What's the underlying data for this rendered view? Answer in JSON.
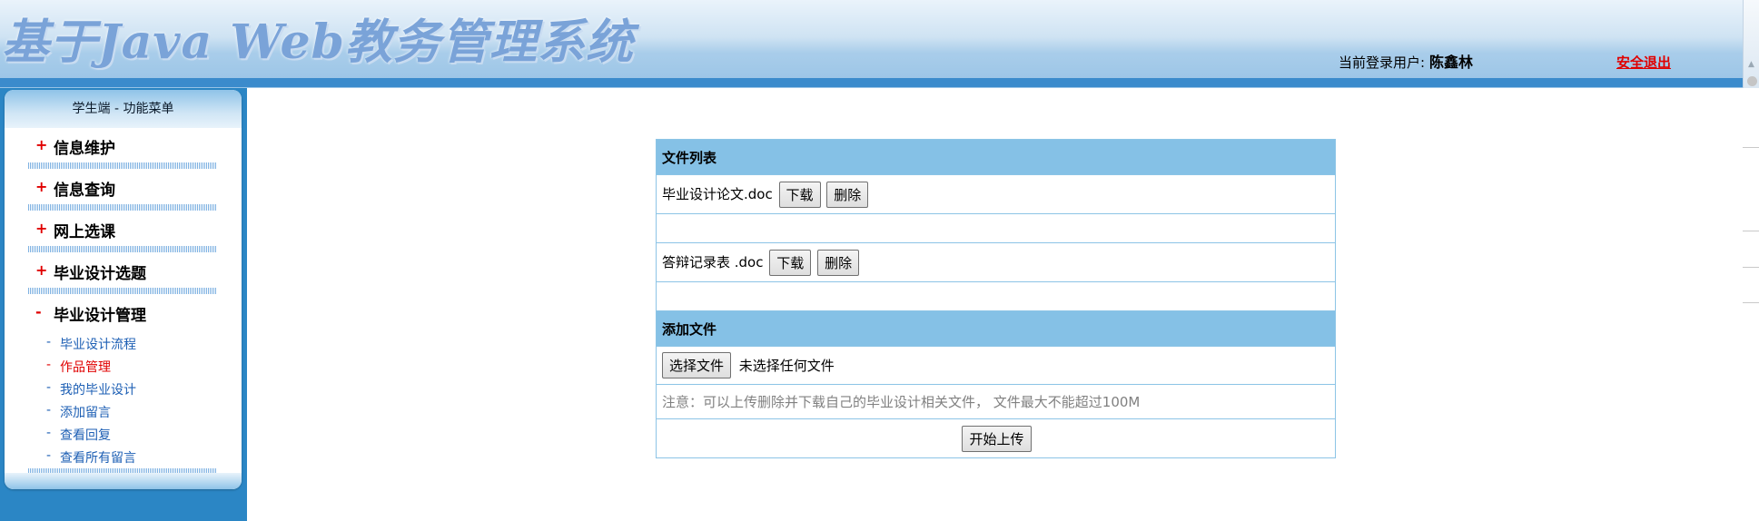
{
  "header": {
    "title": "基于Java Web教务管理系统",
    "login_label": "当前登录用户:",
    "user_name": "陈鑫林",
    "logout": "安全退出"
  },
  "sidebar": {
    "title": "学生端 - 功能菜单",
    "groups": [
      {
        "sign": "+",
        "label": "信息维护"
      },
      {
        "sign": "+",
        "label": "信息查询"
      },
      {
        "sign": "+",
        "label": "网上选课"
      },
      {
        "sign": "+",
        "label": "毕业设计选题"
      },
      {
        "sign": "-",
        "label": "毕业设计管理"
      }
    ],
    "submenu": [
      {
        "sign": "-",
        "label": "毕业设计流程"
      },
      {
        "sign": "-",
        "label": "作品管理",
        "active": true
      },
      {
        "sign": "-",
        "label": "我的毕业设计"
      },
      {
        "sign": "-",
        "label": "添加留言"
      },
      {
        "sign": "-",
        "label": "查看回复"
      },
      {
        "sign": "-",
        "label": "查看所有留言"
      }
    ]
  },
  "file_list": {
    "header": "文件列表",
    "files": [
      {
        "name": "毕业设计论文.doc",
        "download": "下载",
        "delete": "删除"
      },
      {
        "name": "答辩记录表 .doc",
        "download": "下载",
        "delete": "删除"
      }
    ]
  },
  "add_file": {
    "header": "添加文件",
    "choose_label": "选择文件",
    "no_file_text": "未选择任何文件",
    "note": "注意：可以上传删除并下载自己的毕业设计相关文件， 文件最大不能超过100M",
    "submit_label": "开始上传"
  },
  "colors": {
    "sidebar_bg": "#2b86c5",
    "table_header": "#85c1e6",
    "accent_red": "#e00000",
    "link_blue": "#1d5fb4"
  }
}
